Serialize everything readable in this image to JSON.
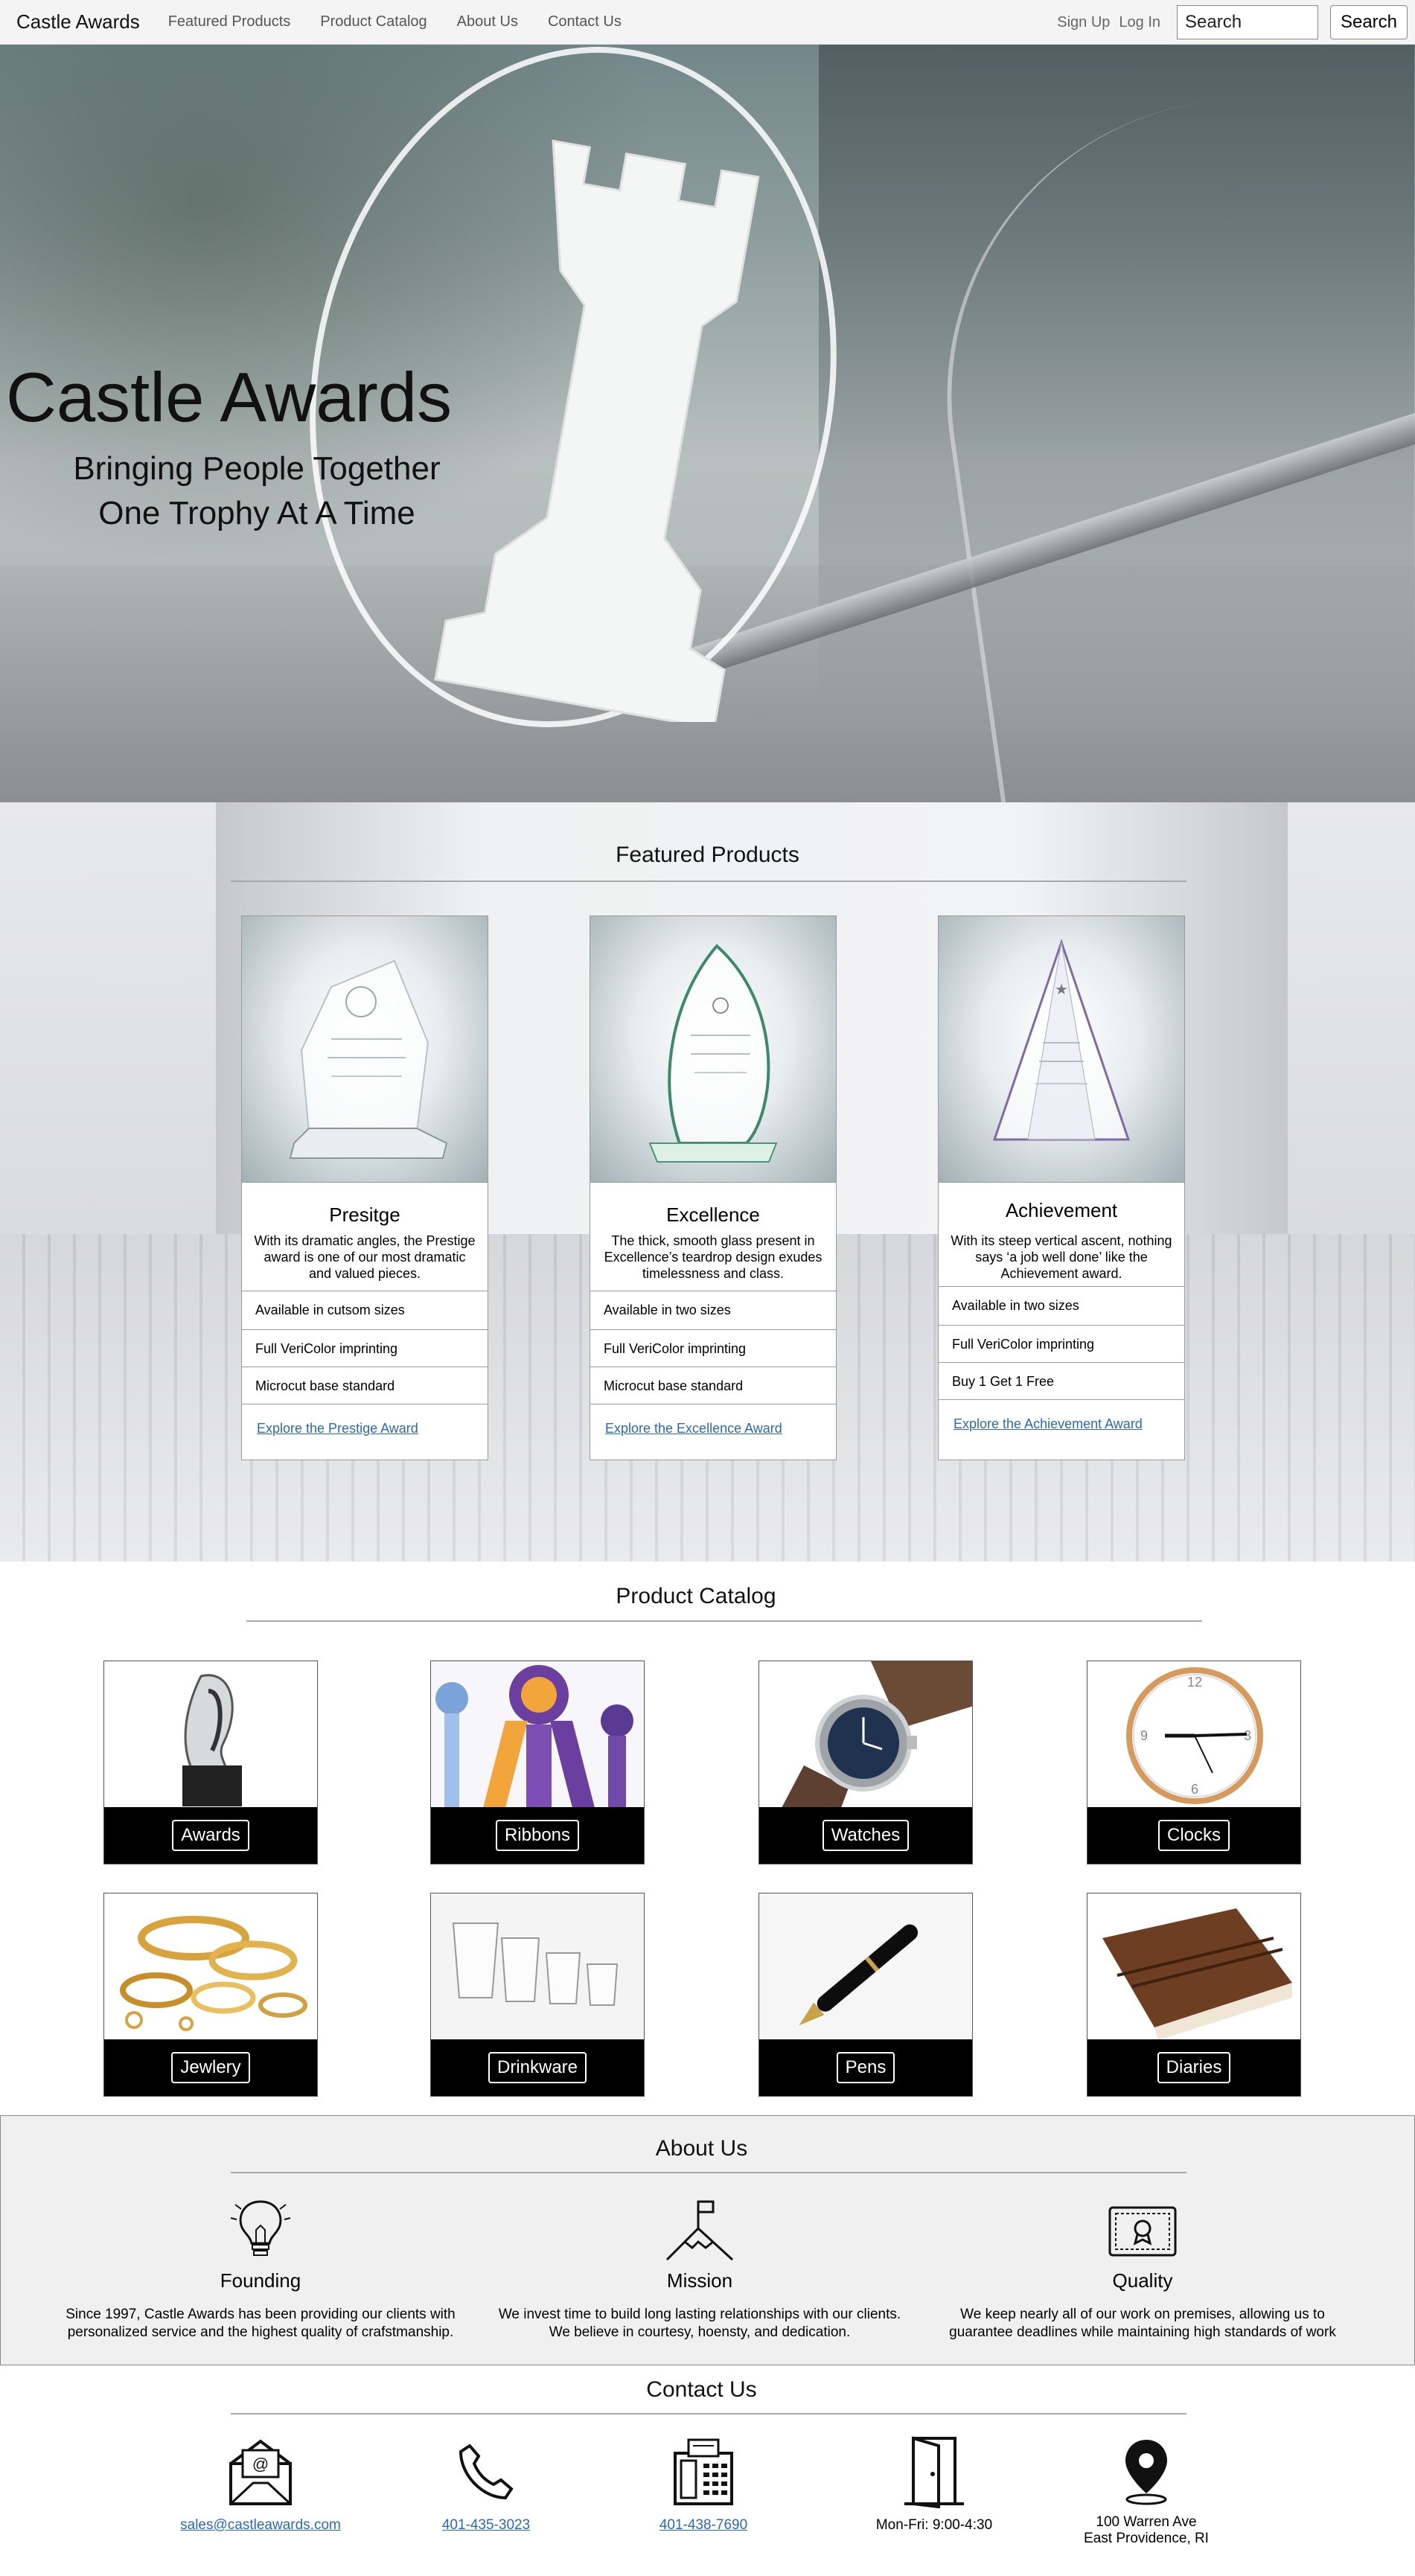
{
  "nav": {
    "brand": "Castle Awards",
    "links": [
      "Featured Products",
      "Product Catalog",
      "About Us",
      "Contact Us"
    ],
    "sign_up": "Sign Up",
    "log_in": "Log In",
    "search_placeholder": "Search",
    "search_button": "Search"
  },
  "hero": {
    "title": "Castle Awards",
    "subtitle_line1": "Bringing People Together",
    "subtitle_line2": "One Trophy At A Time"
  },
  "featured": {
    "heading": "Featured Products",
    "cards": [
      {
        "name": "Presitge",
        "description": "With its dramatic angles, the Prestige award is one of our most dramatic and valued pieces.",
        "features": [
          "Available in cutsom sizes",
          "Full VeriColor imprinting",
          "Microcut base standard"
        ],
        "link": "Explore the Prestige Award"
      },
      {
        "name": "Excellence",
        "description": "The thick, smooth glass present in Excellence’s teardrop design exudes timelessness and class.",
        "features": [
          "Available in two sizes",
          "Full VeriColor imprinting",
          "Microcut base standard"
        ],
        "link": "Explore the Excellence Award"
      },
      {
        "name": "Achievement",
        "description": "With its steep vertical ascent, nothing says ‘a job well done’ like the Achievement award.",
        "features": [
          "Available in two sizes",
          "Full VeriColor imprinting",
          "Buy 1 Get 1 Free"
        ],
        "link": "Explore the Achievement Award"
      }
    ]
  },
  "catalog": {
    "heading": "Product Catalog",
    "items": [
      "Awards",
      "Ribbons",
      "Watches",
      "Clocks",
      "Jewlery",
      "Drinkware",
      "Pens",
      "Diaries"
    ]
  },
  "about": {
    "heading": "About Us",
    "columns": [
      {
        "icon": "lightbulb-icon",
        "title": "Founding",
        "line1": "Since 1997, Castle Awards has been providing our clients with",
        "line2": "personalized service and the highest quality of crafstmanship."
      },
      {
        "icon": "mountain-flag-icon",
        "title": "Mission",
        "line1": "We invest time to build long lasting relationships with our clients.",
        "line2": "We believe in courtesy, hoensty, and dedication."
      },
      {
        "icon": "certificate-icon",
        "title": "Quality",
        "line1": "We keep nearly all of our work on premises, allowing us to",
        "line2": "guarantee deadlines while maintaining high standards of work"
      }
    ]
  },
  "contact": {
    "heading": "Contact Us",
    "email": "sales@castleawards.com",
    "phone": "401-435-3023",
    "fax": "401-438-7690",
    "hours": "Mon-Fri: 9:00-4:30",
    "address_line1": "100 Warren Ave",
    "address_line2": "East Providence, RI"
  },
  "colors": {
    "link": "#2a67c9",
    "catalog_bar": "#000000",
    "about_bg": "#f0f0f0"
  }
}
